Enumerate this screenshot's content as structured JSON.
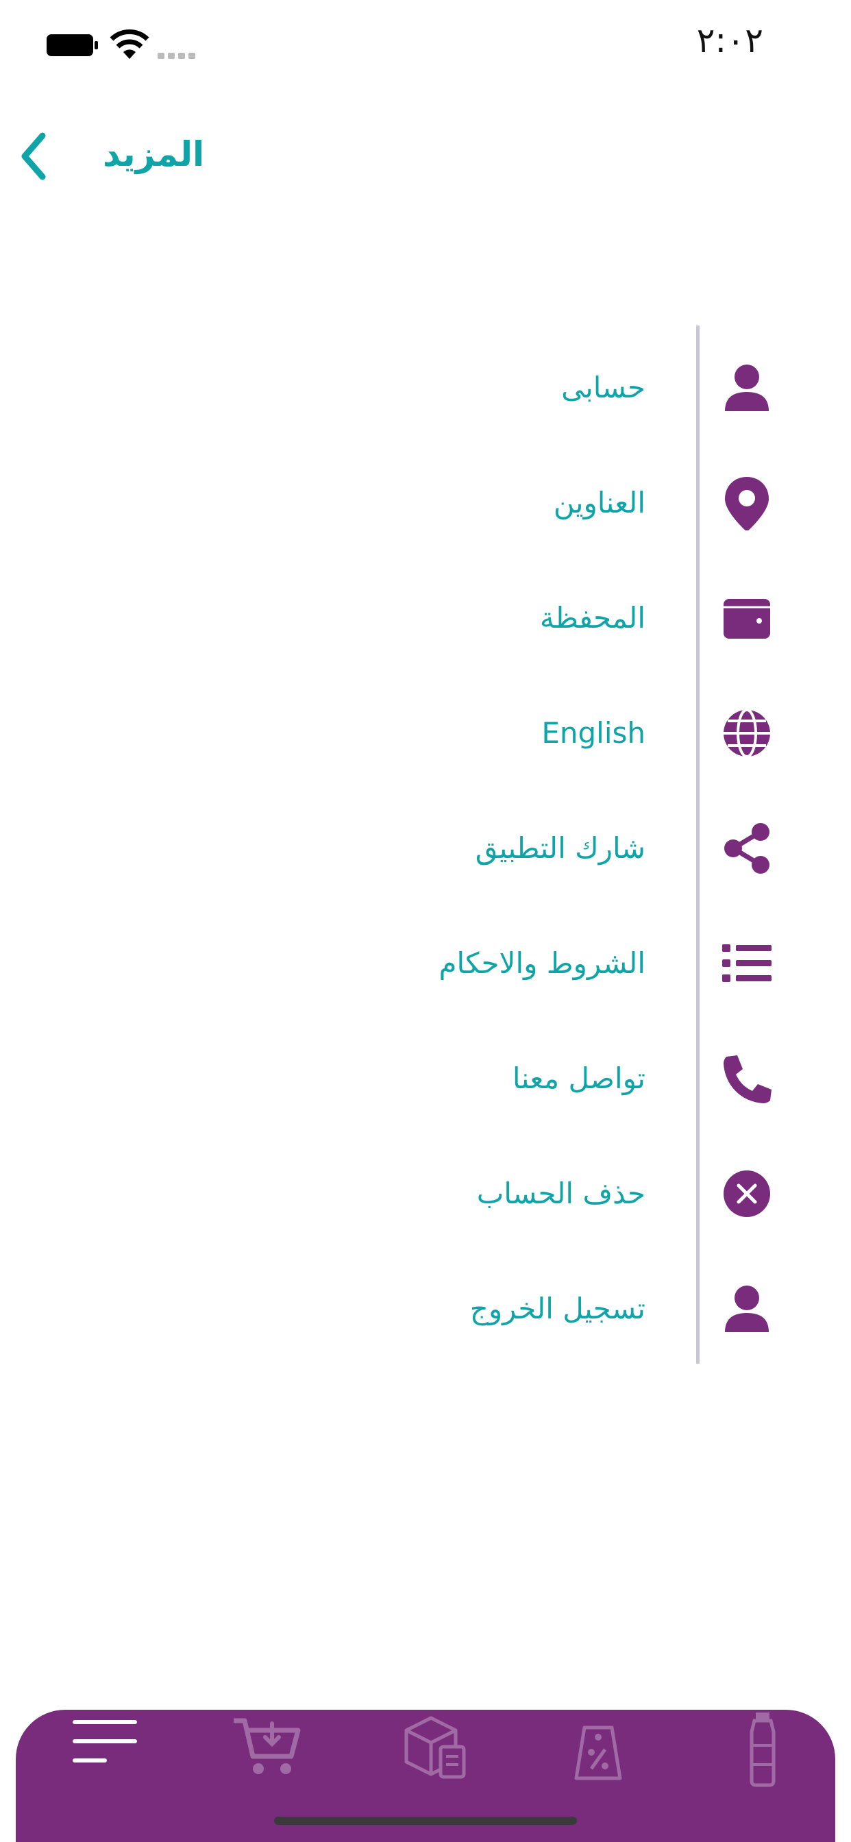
{
  "status_bar": {
    "time": "٢:٠٢",
    "icons": [
      "battery-icon",
      "wifi-icon",
      "signal-icon"
    ]
  },
  "header": {
    "title": "المزيد",
    "back_icon": "chevron-left-icon"
  },
  "menu": {
    "items": [
      {
        "label": "حسابى",
        "icon": "user-icon"
      },
      {
        "label": "العناوين",
        "icon": "map-pin-icon"
      },
      {
        "label": "المحفظة",
        "icon": "wallet-icon"
      },
      {
        "label": "English",
        "icon": "globe-icon"
      },
      {
        "label": "شارك التطبيق",
        "icon": "share-icon"
      },
      {
        "label": "الشروط والاحكام",
        "icon": "list-icon"
      },
      {
        "label": "تواصل معنا",
        "icon": "phone-icon"
      },
      {
        "label": "حذف الحساب",
        "icon": "close-circle-icon"
      },
      {
        "label": "تسجيل الخروج",
        "icon": "user-icon"
      }
    ]
  },
  "bottom_nav": {
    "items": [
      {
        "icon": "menu-icon",
        "active": true
      },
      {
        "icon": "cart-icon",
        "active": false
      },
      {
        "icon": "box-icon",
        "active": false
      },
      {
        "icon": "discount-tag-icon",
        "active": false
      },
      {
        "icon": "bottle-icon",
        "active": false
      }
    ]
  },
  "colors": {
    "accent": "#0fa5a8",
    "brand": "#7a2c7c",
    "divider": "#c9c7d6"
  }
}
